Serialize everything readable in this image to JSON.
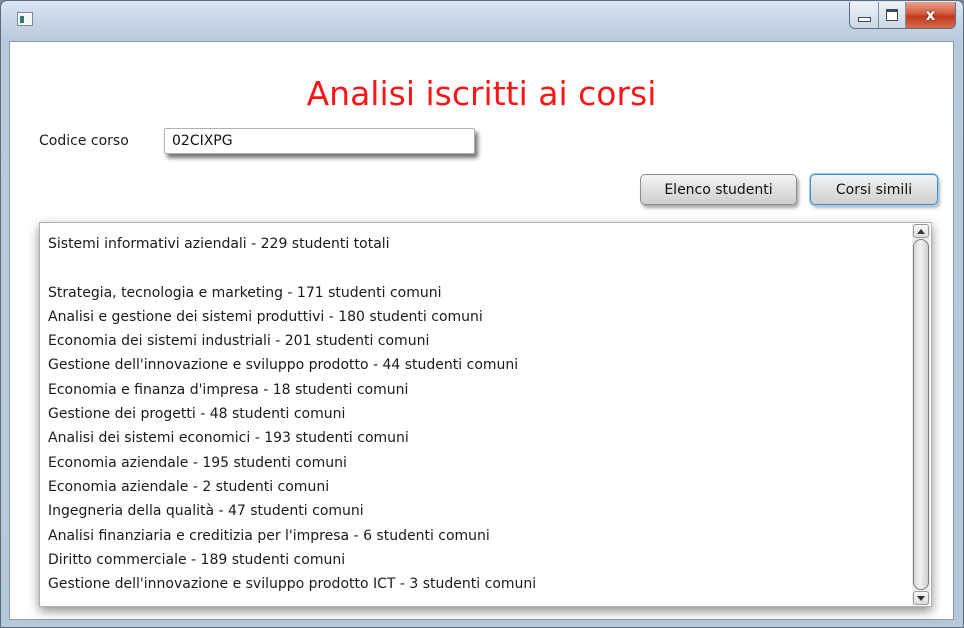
{
  "window": {
    "app_icon": "window-app-icon",
    "controls": {
      "minimize_icon": "minimize-icon",
      "maximize_icon": "maximize-icon",
      "close_label": "x"
    }
  },
  "main": {
    "title": "Analisi iscritti ai corsi",
    "title_color": "#fb1616",
    "course_code": {
      "label": "Codice corso",
      "value": "02CIXPG"
    },
    "buttons": {
      "students_list": "Elenco studenti",
      "similar_courses": "Corsi simili"
    },
    "results": {
      "lines": [
        "Sistemi informativi aziendali - 229 studenti totali",
        "",
        "Strategia, tecnologia e marketing - 171 studenti comuni",
        "Analisi e gestione dei sistemi produttivi - 180 studenti comuni",
        "Economia dei sistemi industriali - 201 studenti comuni",
        "Gestione dell'innovazione e sviluppo prodotto - 44 studenti comuni",
        "Economia e finanza d'impresa - 18 studenti comuni",
        "Gestione dei progetti - 48 studenti comuni",
        "Analisi dei sistemi economici - 193 studenti comuni",
        "Economia aziendale - 195 studenti comuni",
        "Economia aziendale - 2 studenti comuni",
        "Ingegneria della qualità - 47 studenti comuni",
        "Analisi finanziaria e creditizia per l'impresa - 6 studenti comuni",
        "Diritto commerciale - 189 studenti comuni",
        "Gestione dell'innovazione e sviluppo prodotto ICT - 3 studenti comuni"
      ]
    }
  }
}
